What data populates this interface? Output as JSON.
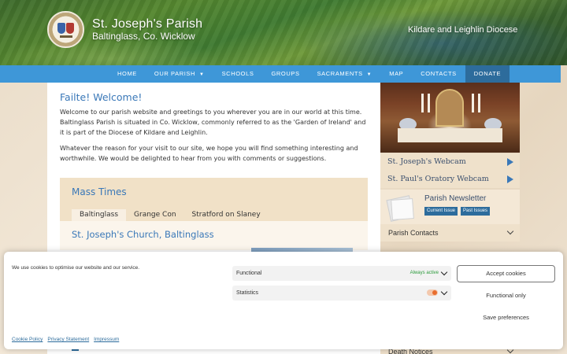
{
  "header": {
    "site_title": "St. Joseph's Parish",
    "site_subtitle": "Baltinglass, Co. Wicklow",
    "diocese": "Kildare and Leighlin Diocese"
  },
  "nav": {
    "items": [
      {
        "label": "HOME",
        "has_dropdown": false
      },
      {
        "label": "OUR PARISH",
        "has_dropdown": true
      },
      {
        "label": "SCHOOLS",
        "has_dropdown": false
      },
      {
        "label": "GROUPS",
        "has_dropdown": false
      },
      {
        "label": "SACRAMENTS",
        "has_dropdown": true
      },
      {
        "label": "MAP",
        "has_dropdown": false
      },
      {
        "label": "CONTACTS",
        "has_dropdown": false
      },
      {
        "label": "DONATE",
        "has_dropdown": false
      }
    ]
  },
  "main": {
    "welcome_title": "Failte! Welcome!",
    "para1": "Welcome to our parish website and greetings to you wherever you are in our world at this time. Baltinglass Parish is situated in Co. Wicklow, commonly referred to as the 'Garden of Ireland' and it is part of the Diocese of Kildare and Leighlin.",
    "para2": "Whatever the reason for your visit to our site, we hope you will find something interesting and worthwhile. We would be delighted to hear from you with comments or suggestions.",
    "mass": {
      "title": "Mass Times",
      "tabs": [
        "Baltinglass",
        "Grange Con",
        "Stratford on Slaney"
      ],
      "active_tab": "Baltinglass",
      "church_title": "St. Joseph's Church, Baltinglass"
    }
  },
  "sidebar": {
    "webcams": [
      "St. Joseph's Webcam",
      "St. Paul's Oratory Webcam"
    ],
    "newsletter": {
      "title": "Parish Newsletter",
      "current": "Current Issue",
      "past": "Past Issues"
    },
    "contacts": "Parish Contacts",
    "death_notices": "Death Notices"
  },
  "cookie": {
    "message": "We use cookies to optimise our website and our service.",
    "categories": [
      {
        "label": "Functional",
        "status": "Always active"
      },
      {
        "label": "Statistics",
        "status": ""
      }
    ],
    "accept": "Accept cookies",
    "functional_only": "Functional only",
    "save": "Save preferences",
    "links": [
      "Cookie Policy",
      "Privacy Statement",
      "Impressum"
    ]
  },
  "colors": {
    "nav_bg": "#3e97d8",
    "donate_bg": "#2d6c9c",
    "title_blue": "#3a78b8",
    "accent_orange": "#e86d2e",
    "active_green": "#2a9a3a"
  }
}
